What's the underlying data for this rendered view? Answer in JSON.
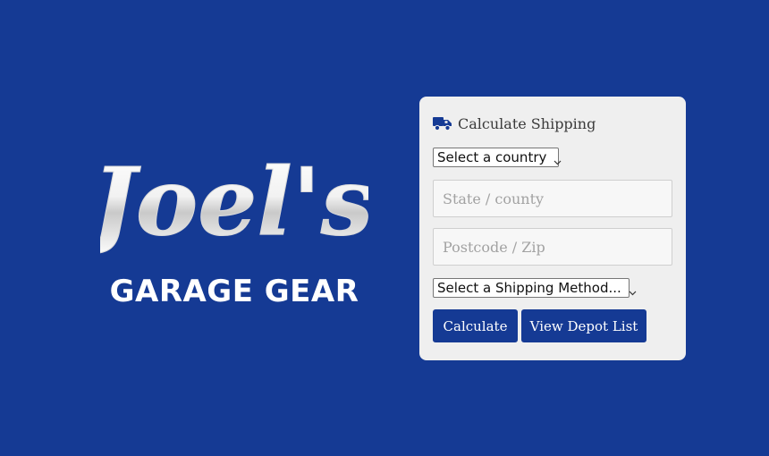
{
  "logo": {
    "script_text": "Joel's",
    "tagline": "GARAGE GEAR"
  },
  "panel": {
    "icon": "truck-icon",
    "title": "Calculate Shipping",
    "country_select": {
      "selected": "Select a country"
    },
    "state_input": {
      "value": "",
      "placeholder": "State / county"
    },
    "zip_input": {
      "value": "",
      "placeholder": "Postcode / Zip"
    },
    "shipping_select": {
      "selected": "Select a Shipping Method..."
    },
    "buttons": {
      "calculate": "Calculate",
      "depot": "View Depot List"
    }
  },
  "colors": {
    "background": "#153a94",
    "panel": "#efefef",
    "button": "#153a94"
  }
}
